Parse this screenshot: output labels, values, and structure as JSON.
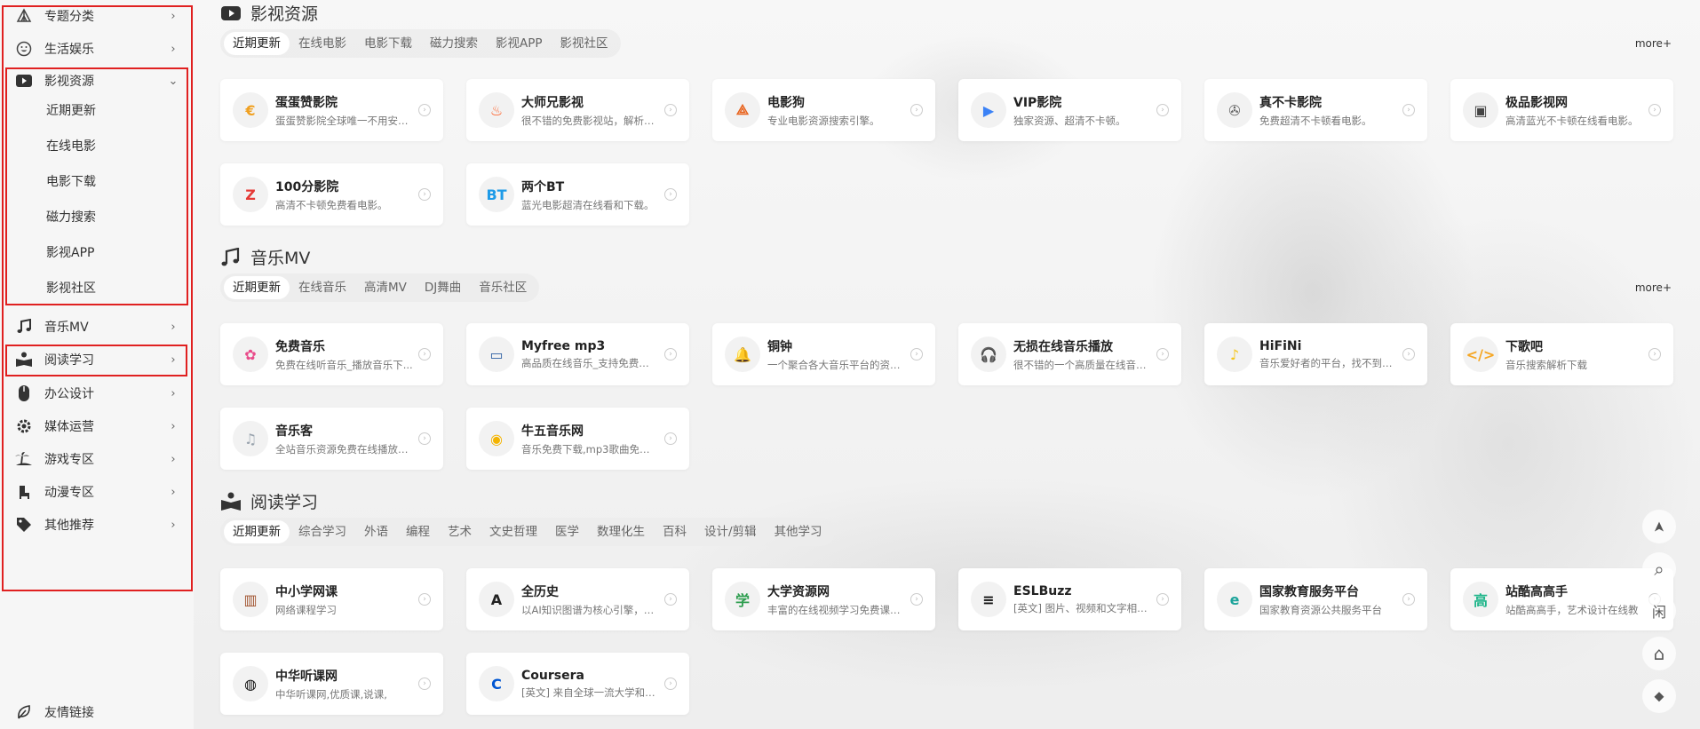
{
  "sidebar": {
    "items": [
      {
        "label": "专题分类",
        "icon": "tent-icon"
      },
      {
        "label": "生活娱乐",
        "icon": "smile-icon"
      },
      {
        "label": "影视资源",
        "icon": "video-play-icon"
      },
      {
        "label": "音乐MV",
        "icon": "music-note-icon"
      },
      {
        "label": "阅读学习",
        "icon": "book-reader-icon"
      },
      {
        "label": "办公设计",
        "icon": "mouse-icon"
      },
      {
        "label": "媒体运营",
        "icon": "gear-icon"
      },
      {
        "label": "游戏专区",
        "icon": "island-icon"
      },
      {
        "label": "动漫专区",
        "icon": "armchair-icon"
      },
      {
        "label": "其他推荐",
        "icon": "tag-icon"
      }
    ],
    "video_subitems": [
      "近期更新",
      "在线电影",
      "电影下载",
      "磁力搜索",
      "影视APP",
      "影视社区"
    ],
    "chevron_right": "›",
    "chevron_down": "⌄",
    "footer_link": {
      "label": "友情链接",
      "icon": "leaf-icon"
    }
  },
  "sections": {
    "video": {
      "title": "影视资源",
      "tabs": [
        "近期更新",
        "在线电影",
        "电影下载",
        "磁力搜索",
        "影视APP",
        "影视社区"
      ],
      "more": "more+",
      "cards": [
        {
          "name": "蛋蛋赞影院",
          "desc": "蛋蛋赞影院全球唯一不用安装...",
          "logo_text": "€",
          "logo_color": "#f0a020"
        },
        {
          "name": "大师兄影视",
          "desc": "很不错的免费影视站，解析多...",
          "logo_text": "♨",
          "logo_color": "#ff5a1f"
        },
        {
          "name": "电影狗",
          "desc": "专业电影资源搜索引擎。",
          "logo_text": "⟁",
          "logo_color": "#e8611a"
        },
        {
          "name": "VIP影院",
          "desc": "独家资源、超清不卡顿。",
          "logo_text": "▶",
          "logo_color": "#3b82f6"
        },
        {
          "name": "真不卡影院",
          "desc": "免费超清不卡顿看电影。",
          "logo_text": "✇",
          "logo_color": "#666666"
        },
        {
          "name": "极品影视网",
          "desc": "高清蓝光不卡顿在线看电影。",
          "logo_text": "▣",
          "logo_color": "#444444"
        },
        {
          "name": "100分影院",
          "desc": "高清不卡顿免费看电影。",
          "logo_text": "Z",
          "logo_color": "#e53935"
        },
        {
          "name": "两个BT",
          "desc": "蓝光电影超清在线看和下载。",
          "logo_text": "BT",
          "logo_color": "#1e9be8"
        }
      ]
    },
    "music": {
      "title": "音乐MV",
      "tabs": [
        "近期更新",
        "在线音乐",
        "高清MV",
        "DJ舞曲",
        "音乐社区"
      ],
      "more": "more+",
      "cards": [
        {
          "name": "免费音乐",
          "desc": "免费在线听音乐_播放音乐下...",
          "logo_text": "✿",
          "logo_color": "#e94b8a"
        },
        {
          "name": "Myfree mp3",
          "desc": "高品质在线音乐_支持免费下载",
          "logo_text": "▭",
          "logo_color": "#2d5fa3"
        },
        {
          "name": "铜钟",
          "desc": "一个聚合各大音乐平台的资源...",
          "logo_text": "🔔",
          "logo_color": "#f29c11"
        },
        {
          "name": "无损在线音乐播放",
          "desc": "很不错的一个高质量在线音乐...",
          "logo_text": "🎧",
          "logo_color": "#1e88e5"
        },
        {
          "name": "HiFiNi",
          "desc": "音乐爱好者的平台，找不到音...",
          "logo_text": "♪",
          "logo_color": "#f5c518"
        },
        {
          "name": "下歌吧",
          "desc": "音乐搜索解析下载",
          "logo_text": "</>",
          "logo_color": "#f5a623"
        },
        {
          "name": "音乐客",
          "desc": "全站音乐资源免费在线播放和...",
          "logo_text": "♫",
          "logo_color": "#9aa4ae"
        },
        {
          "name": "牛五音乐网",
          "desc": "音乐免费下载,mp3歌曲免费...",
          "logo_text": "◉",
          "logo_color": "#f4b400"
        }
      ]
    },
    "reading": {
      "title": "阅读学习",
      "tabs": [
        "近期更新",
        "综合学习",
        "外语",
        "编程",
        "艺术",
        "文史哲理",
        "医学",
        "数理化生",
        "百科",
        "设计/剪辑",
        "其他学习"
      ],
      "cards": [
        {
          "name": "中小学网课",
          "desc": "网络课程学习",
          "logo_text": "▥",
          "logo_color": "#a0522d"
        },
        {
          "name": "全历史",
          "desc": "以AI知识图谱为核心引擎，通...",
          "logo_text": "A",
          "logo_color": "#222222"
        },
        {
          "name": "大学资源网",
          "desc": "丰富的在线视频学习免费课程...",
          "logo_text": "学",
          "logo_color": "#2e9e4f"
        },
        {
          "name": "ESLBuzz",
          "desc": "[英文] 图片、视频和文字相结...",
          "logo_text": "≡",
          "logo_color": "#111111"
        },
        {
          "name": "国家教育服务平台",
          "desc": "国家教育资源公共服务平台",
          "logo_text": "e",
          "logo_color": "#1aa39a"
        },
        {
          "name": "站酷高高手",
          "desc": "站酷高高手，艺术设计在线教",
          "logo_text": "高",
          "logo_color": "#1fb58a"
        },
        {
          "name": "中华听课网",
          "desc": "中华听课网,优质课,说课,",
          "logo_text": "◍",
          "logo_color": "#111111"
        },
        {
          "name": "Coursera",
          "desc": "[英文] 来自全球一流大学和公...",
          "logo_text": "C",
          "logo_color": "#0056d2"
        }
      ]
    }
  },
  "floating": {
    "top": "➤",
    "search": "⌕",
    "idle": "闲",
    "home": "⌂",
    "tag": "⬥"
  }
}
